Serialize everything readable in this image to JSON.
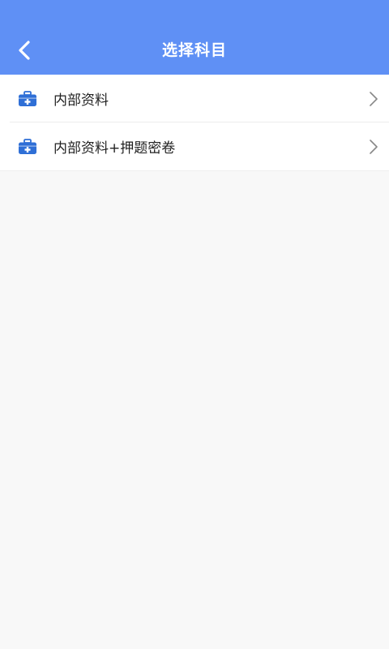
{
  "header": {
    "title": "选择科目",
    "back_icon": "chevron-left-icon",
    "background_color": "#5f90f5"
  },
  "subjects": [
    {
      "label": "内部资料",
      "icon": "medical-kit-icon",
      "action_icon": "chevron-right-icon"
    },
    {
      "label": "内部资料+押题密卷",
      "icon": "medical-kit-icon",
      "action_icon": "chevron-right-icon"
    }
  ],
  "colors": {
    "icon_blue": "#2f6fd6",
    "page_background": "#f8f8f8"
  }
}
